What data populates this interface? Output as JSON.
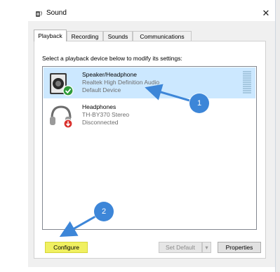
{
  "window": {
    "title": "Sound",
    "close_glyph": "✕",
    "icon": "speaker-icon"
  },
  "tabs": [
    {
      "label": "Playback",
      "active": true
    },
    {
      "label": "Recording",
      "active": false
    },
    {
      "label": "Sounds",
      "active": false
    },
    {
      "label": "Communications",
      "active": false
    }
  ],
  "panel": {
    "instruction": "Select a playback device below to modify its settings:"
  },
  "devices": [
    {
      "name": "Speaker/Headphone",
      "line2": "Realtek High Definition Audio",
      "line3": "Default Device",
      "selected": true,
      "status_icon": "check-badge-icon"
    },
    {
      "name": "Headphones",
      "line2": "TH-BY370 Stereo",
      "line3": "Disconnected",
      "selected": false,
      "status_icon": "disconnected-badge-icon"
    }
  ],
  "buttons": {
    "configure": "Configure",
    "set_default": "Set Default",
    "dropdown_glyph": "▾",
    "properties": "Properties"
  },
  "callouts": {
    "one": "1",
    "two": "2"
  },
  "colors": {
    "selection": "#cce8ff",
    "callout": "#3d86d8",
    "configure_highlight": "#f0f060"
  }
}
